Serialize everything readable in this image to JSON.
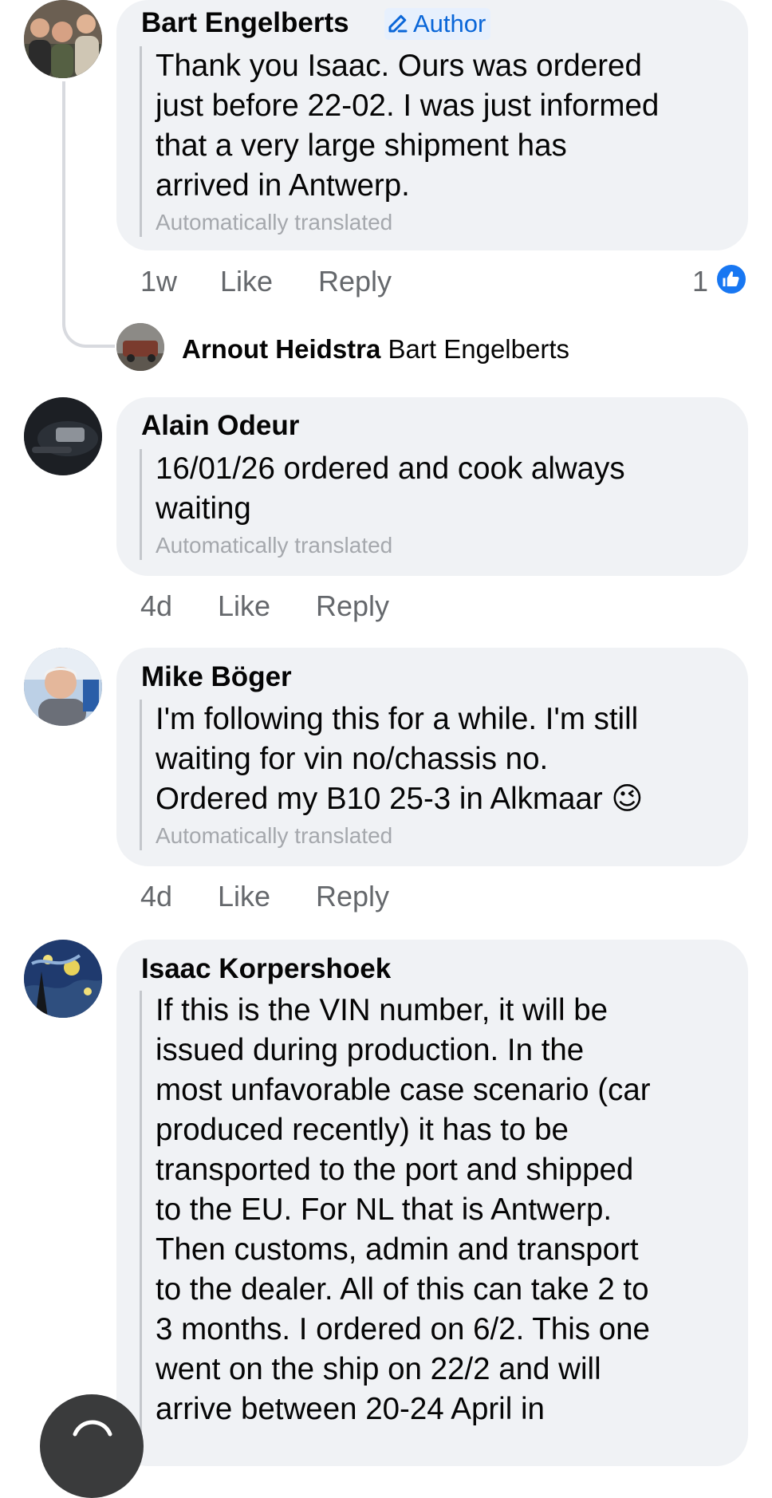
{
  "comments": [
    {
      "author": "Bart Engelberts",
      "badge": "Author",
      "text": "Thank you Isaac. Ours was ordered\njust before 22-02. I was just informed\nthat a very large shipment has\narrived in Antwerp.",
      "translated": "Automatically translated",
      "time": "1w",
      "like": "Like",
      "reply": "Reply",
      "reactions": "1",
      "reply_preview": {
        "author": "Arnout Heidstra",
        "mention": "Bart Engelberts"
      }
    },
    {
      "author": "Alain Odeur",
      "text": "16/01/26 ordered and cook always\nwaiting",
      "translated": "Automatically translated",
      "time": "4d",
      "like": "Like",
      "reply": "Reply"
    },
    {
      "author": "Mike Böger",
      "text": "I'm following this for a while. I'm still\nwaiting for vin no/chassis no.\nOrdered my B10 25-3 in Alkmaar",
      "emoji": "😉",
      "translated": "Automatically translated",
      "time": "4d",
      "like": "Like",
      "reply": "Reply"
    },
    {
      "author": "Isaac Korpershoek",
      "text": "If this is the VIN number, it will be\nissued during production. In the\nmost unfavorable case scenario (car\nproduced recently) it has to be\ntransported to the port and shipped\nto the EU. For NL that is Antwerp.\nThen customs, admin and transport\nto the dealer. All of this can take 2 to\n3 months. I ordered on 6/2. This one\nwent on the ship on 22/2 and will\narrive between 20-24 April in"
    }
  ],
  "colors": {
    "bubble": "#f0f2f5",
    "badge_bg": "#e7f0fd",
    "accent": "#1877f2",
    "meta_text": "#65686c"
  },
  "icons": [
    "pencil-icon",
    "thumbs-up-icon",
    "floating-action-icon"
  ]
}
